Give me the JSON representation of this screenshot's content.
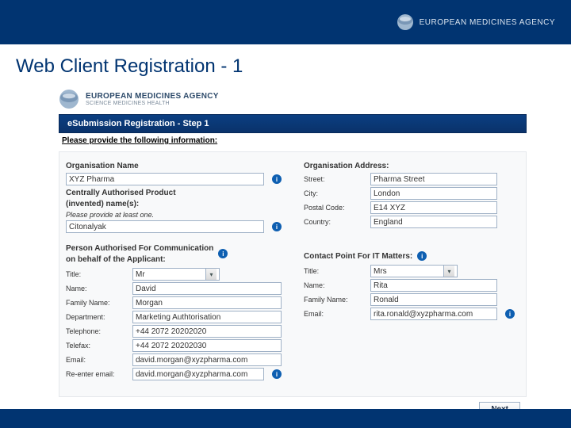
{
  "header": {
    "agency_name": "EUROPEAN MEDICINES AGENCY"
  },
  "slide_title": "Web Client Registration - 1",
  "app_logo": {
    "line1": "EUROPEAN MEDICINES AGENCY",
    "line2": "SCIENCE MEDICINES HEALTH"
  },
  "step_bar": "eSubmission Registration - Step 1",
  "subhead": "Please provide the following information:",
  "org": {
    "name_label": "Organisation Name",
    "name_value": "XYZ Pharma",
    "cap_label_1": "Centrally Authorised Product",
    "cap_label_2": "(invented) name(s):",
    "cap_sub": "Please provide at least one.",
    "cap_value": "Citonalyak"
  },
  "address": {
    "heading": "Organisation Address:",
    "street_label": "Street:",
    "street_value": "Pharma Street",
    "city_label": "City:",
    "city_value": "London",
    "postal_label": "Postal Code:",
    "postal_value": "E14 XYZ",
    "country_label": "Country:",
    "country_value": "England"
  },
  "applicant": {
    "heading_l1": "Person Authorised For Communication",
    "heading_l2": "on behalf of the Applicant:",
    "title_label": "Title:",
    "title_value": "Mr",
    "name_label": "Name:",
    "name_value": "David",
    "family_label": "Family Name:",
    "family_value": "Morgan",
    "dept_label": "Department:",
    "dept_value": "Marketing Authtorisation",
    "tel_label": "Telephone:",
    "tel_value": "+44 2072 20202020",
    "fax_label": "Telefax:",
    "fax_value": "+44 2072 20202030",
    "email_label": "Email:",
    "email_value": "david.morgan@xyzpharma.com",
    "reemail_label": "Re-enter email:",
    "reemail_value": "david.morgan@xyzpharma.com"
  },
  "it": {
    "heading": "Contact Point For IT Matters:",
    "title_label": "Title:",
    "title_value": "Mrs",
    "name_label": "Name:",
    "name_value": "Rita",
    "family_label": "Family Name:",
    "family_value": "Ronald",
    "email_label": "Email:",
    "email_value": "rita.ronald@xyzpharma.com"
  },
  "next_label": "Next"
}
